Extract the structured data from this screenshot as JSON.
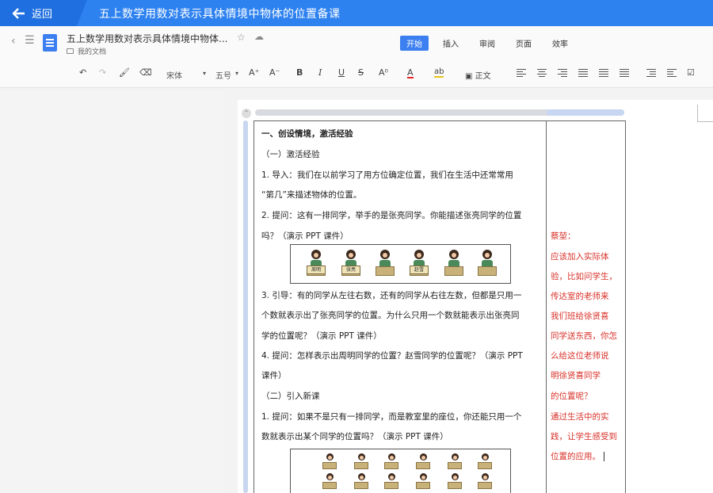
{
  "topbar": {
    "back_label": "返回",
    "title": "五上数学用数对表示具体情境中物体的位置备课"
  },
  "docbar": {
    "title": "五上数学用数对表示具体情境中物体...",
    "folder": "我的文档",
    "tabs": [
      {
        "label": "开始",
        "active": true
      },
      {
        "label": "插入",
        "active": false
      },
      {
        "label": "审阅",
        "active": false
      },
      {
        "label": "页面",
        "active": false
      },
      {
        "label": "效率",
        "active": false
      }
    ]
  },
  "toolbar": {
    "font_name": "宋体",
    "font_size": "五号",
    "grow_font": "A⁺",
    "shrink_font": "A⁻",
    "bold": "B",
    "italic": "I",
    "underline": "U",
    "strike": "S",
    "superscript": "A⁰",
    "font_color": "A",
    "highlight": "ab",
    "style": "正文"
  },
  "document": {
    "lines": [
      {
        "text": "一、创设情境，激活经验",
        "bold": true
      },
      {
        "text": "（一）激活经验",
        "bold": false
      },
      {
        "text": "1. 导入：我们在以前学习了用方位确定位置，我们在生活中还常常用",
        "bold": false
      },
      {
        "text": "“第几”来描述物体的位置。",
        "bold": false
      },
      {
        "text": "2. 提问：这有一排同学，举手的是张亮同学。你能描述张亮同学的位置",
        "bold": false
      },
      {
        "text": "吗？（演示 PPT 课件）",
        "bold": false
      },
      {
        "text": "3. 引导：有的同学从左往右数，还有的同学从右往左数，但都是只用一",
        "bold": false
      },
      {
        "text": "个数就表示出了张亮同学的位置。为什么只用一个数就能表示出张亮同",
        "bold": false
      },
      {
        "text": "学的位置呢？（演示 PPT 课件）",
        "bold": false
      },
      {
        "text": "4. 提问：怎样表示出周明同学的位置？赵雪同学的位置呢？（演示 PPT",
        "bold": false
      },
      {
        "text": "课件）",
        "bold": false
      },
      {
        "text": "（二）引入新课",
        "bold": false
      },
      {
        "text": "1. 提问：如果不是只有一排同学，而是教室里的座位，你还能只用一个",
        "bold": false
      },
      {
        "text": "数就表示出某个同学的位置吗？（演示 PPT 课件）",
        "bold": false
      }
    ],
    "illustration_signs": [
      "周明",
      "张亮",
      "",
      "赵雪",
      "",
      ""
    ],
    "comment_lines": [
      "蔡堃：",
      "应该加入实际体",
      "验，比如问学生，",
      "传达室的老师来",
      "我们班给徐贤喜",
      "同学送东西，你怎",
      "么给这位老师说",
      "明徐贤喜同学",
      "的位置呢？",
      "通过生活中的实",
      "践，让学生感受到",
      "位置的应用。"
    ]
  },
  "colors": {
    "topbar": "#2e82f0",
    "accent": "#3b7ff0",
    "comment": "#d8322a"
  }
}
